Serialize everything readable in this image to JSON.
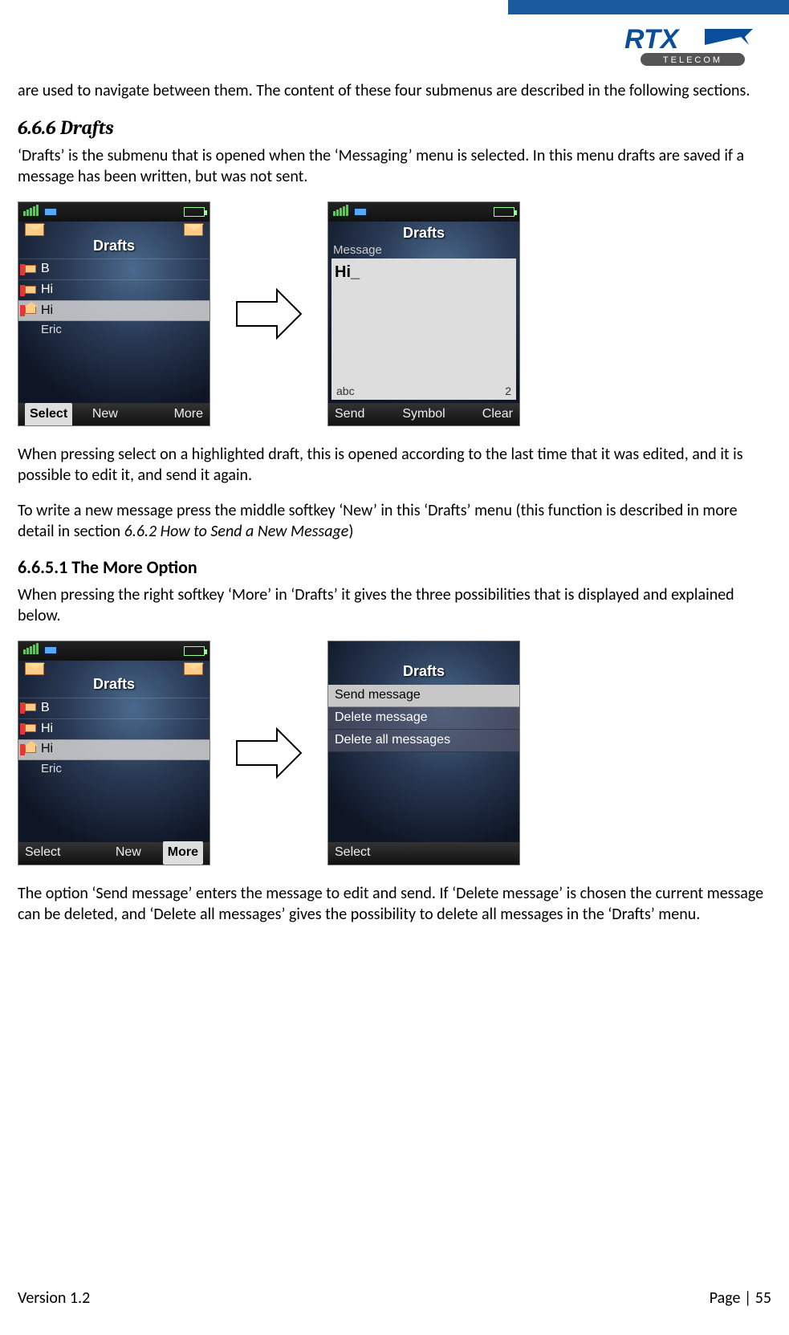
{
  "logo": {
    "brand": "RTX",
    "sub": "TELECOM"
  },
  "intro": "are used to navigate between them. The content of these four submenus are described in the following sections.",
  "s666": {
    "heading": "6.6.6 Drafts",
    "p1": "‘Drafts’ is the submenu that is opened when the ‘Messaging’ menu is selected. In this menu drafts are saved if a message has been written, but was not sent.",
    "p2": "When pressing select on a highlighted draft, this is opened according to the last time that it was edited, and it is possible to edit it, and send it again.",
    "p3a": "To write a new message press the middle softkey ‘New’ in this ‘Drafts’ menu (this function is described in more detail in section ",
    "p3b": "6.6.2 How to Send a New Message",
    "p3c": ")"
  },
  "s6651": {
    "heading": "6.6.5.1 The More Option",
    "p1": "When pressing the right softkey ‘More’ in ‘Drafts’ it gives the three possibilities that is displayed and explained below.",
    "p2": "The option ‘Send message’ enters the message to edit and send. If ‘Delete message’ is chosen the current message can be deleted, and ‘Delete all messages’ gives the possibility to delete all messages in the ‘Drafts’ menu."
  },
  "phone_drafts": {
    "title": "Drafts",
    "rows": [
      {
        "label": "B",
        "sub": null,
        "selected": false
      },
      {
        "label": "Hi",
        "sub": null,
        "selected": false
      },
      {
        "label": "Hi",
        "sub": "Eric",
        "selected": true
      }
    ],
    "softkeys": {
      "left": "Select",
      "center": "New",
      "right": "More"
    }
  },
  "phone_editor": {
    "title": "Drafts",
    "label": "Message",
    "text": "Hi_",
    "mode": "abc",
    "count": "2",
    "softkeys": {
      "left": "Send",
      "center": "Symbol",
      "right": "Clear"
    }
  },
  "phone_more": {
    "title": "Drafts",
    "options": [
      "Send message",
      "Delete message",
      "Delete all messages"
    ],
    "softkeys": {
      "left": "Select",
      "center": "",
      "right": ""
    }
  },
  "footer": {
    "version": "Version 1.2",
    "page": "Page | 55"
  }
}
